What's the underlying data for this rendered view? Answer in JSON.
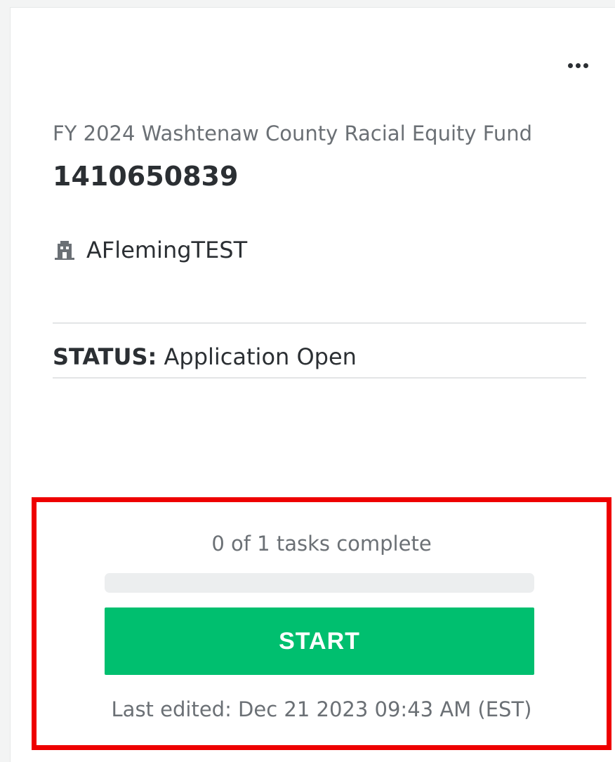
{
  "card": {
    "program_name": "FY 2024 Washtenaw County Racial Equity Fund",
    "application_id": "1410650839",
    "organization": {
      "icon": "building-icon",
      "name": "AFlemingTEST"
    },
    "status": {
      "label": "STATUS:",
      "value": "Application Open"
    },
    "more_menu_icon": "more-horizontal-icon"
  },
  "tasks": {
    "summary": "0 of 1 tasks complete",
    "completed": 0,
    "total": 1,
    "progress_percent": 0,
    "start_label": "START",
    "last_edited": "Last edited: Dec 21 2023 09:43 AM (EST)"
  },
  "colors": {
    "accent_green": "#00bf6f",
    "highlight_red": "#ee0000",
    "text_primary": "#2b2f33",
    "text_secondary": "#6b7075"
  }
}
